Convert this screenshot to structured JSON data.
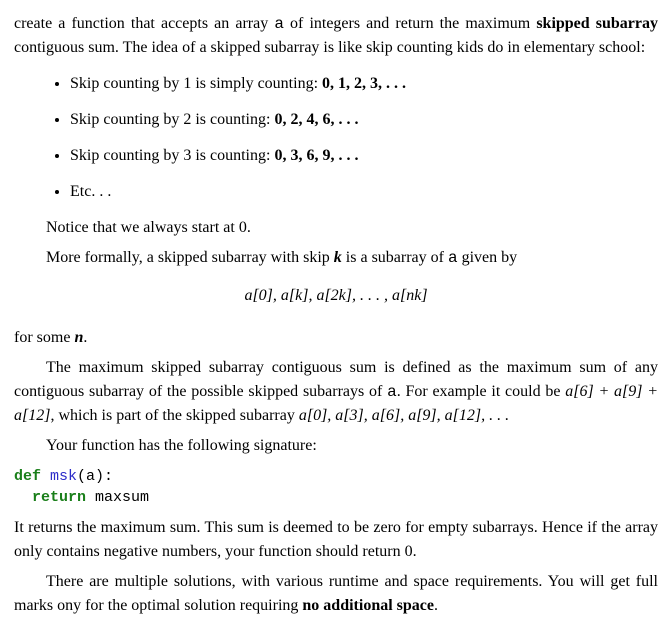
{
  "para1": {
    "lead": "create a function that accepts an array ",
    "arr": "a",
    "after_arr": " of integers and return the maximum ",
    "bold1": "skipped subarray",
    "after_bold": " contiguous sum. The idea of a skipped subarray is like skip counting kids do in elementary school:"
  },
  "bullets": [
    {
      "text": "Skip counting by 1 is simply counting: ",
      "seq": "0, 1, 2, 3, . . ."
    },
    {
      "text": "Skip counting by 2 is counting: ",
      "seq": "0, 2, 4, 6, . . ."
    },
    {
      "text": "Skip counting by 3 is counting: ",
      "seq": "0, 3, 6, 9, . . ."
    },
    {
      "text": "Etc. . .",
      "seq": ""
    }
  ],
  "notice": "Notice that we always start at 0.",
  "formal": {
    "pre": "More formally, a skipped subarray with skip ",
    "k": "k",
    "mid": " is a subarray of ",
    "arr": "a",
    "post": " given by"
  },
  "formula": "a[0], a[k], a[2k], . . . , a[nk]",
  "for_some": {
    "pre": "for some ",
    "n": "n",
    "post": "."
  },
  "maxdef": {
    "line1_pre": "The maximum skipped subarray contiguous sum is defined as the maximum sum of any contiguous subarray of the possible skipped subarrays of ",
    "arr": "a",
    "line1_post": ". For example it could be ",
    "expr": "a[6] + a[9] + a[12]",
    "mid": ", which is part of the skipped subarray ",
    "sub": "a[0], a[3], a[6], a[9], a[12], . . ."
  },
  "sig_intro": "Your function has the following signature:",
  "code": {
    "def_kw": "def",
    "fn": "msk",
    "args": "(a):",
    "return_kw": "return",
    "retval": "maxsum"
  },
  "returns": "It returns the maximum sum. This sum is deemed to be zero for empty subarrays. Hence if the array only contains negative numbers, your function should return 0.",
  "multisol": {
    "pre": "There are multiple solutions, with various runtime and space requirements. You will get full marks ony for the optimal solution requiring ",
    "bold": "no additional space",
    "post": "."
  }
}
